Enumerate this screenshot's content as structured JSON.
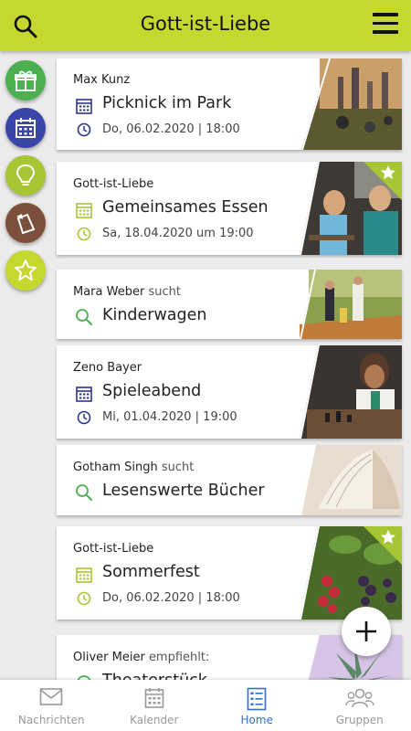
{
  "header": {
    "title": "Gott-ist-Liebe"
  },
  "sidebar": [
    {
      "name": "gift-icon",
      "color": "#4caf50"
    },
    {
      "name": "calendar-icon",
      "color": "#3a45a8"
    },
    {
      "name": "lightbulb-icon",
      "color": "#a6c634"
    },
    {
      "name": "note-icon",
      "color": "#7b4f3a"
    },
    {
      "name": "star-icon",
      "color": "#c6d82f"
    }
  ],
  "cards": [
    {
      "who": "Max Kunz",
      "suffix": "",
      "title": "Picknick im Park",
      "date": "Do, 06.02.2020 | 18:00"
    },
    {
      "who": "Gott-ist-Liebe",
      "suffix": "",
      "title": "Gemeinsames Essen",
      "date": "Sa, 18.04.2020 um 19:00"
    },
    {
      "who": "Mara Weber",
      "suffix": "sucht",
      "title": "Kinderwagen"
    },
    {
      "who": "Zeno Bayer",
      "suffix": "",
      "title": "Spieleabend",
      "date": "Mi, 01.04.2020 | 19:00"
    },
    {
      "who": "Gotham Singh",
      "suffix": "sucht",
      "title": "Lesenswerte Bücher"
    },
    {
      "who": "Gott-ist-Liebe",
      "suffix": "",
      "title": "Sommerfest",
      "date": "Do, 06.02.2020 | 18:00"
    },
    {
      "who": "Oliver Meier",
      "suffix": "empfiehlt:",
      "title": "Theaterstück"
    }
  ],
  "nav": [
    {
      "label": "Nachrichten",
      "icon": "envelope-icon"
    },
    {
      "label": "Kalender",
      "icon": "calendar-icon"
    },
    {
      "label": "Home",
      "icon": "home-list-icon",
      "active": true
    },
    {
      "label": "Gruppen",
      "icon": "group-icon"
    }
  ],
  "colors": {
    "accent": "#c6d82f",
    "navy": "#2b3590",
    "green": "#4caf50",
    "active": "#2f6fd4"
  }
}
